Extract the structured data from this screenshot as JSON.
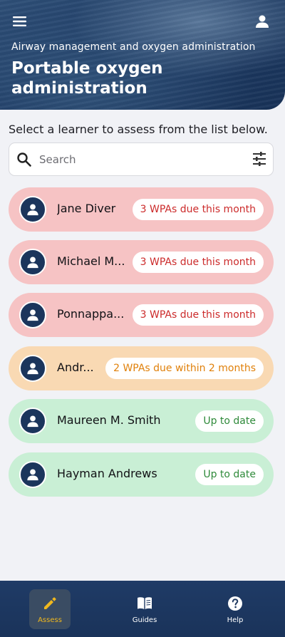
{
  "header": {
    "subtitle": "Airway management and oxygen administration",
    "title": "Portable oxygen administration",
    "menu_icon": "menu-icon",
    "user_icon": "account-icon"
  },
  "instruction": "Select a learner to assess from the list below.",
  "search": {
    "placeholder": "Search",
    "value": ""
  },
  "learners": [
    {
      "name": "Jane Diver",
      "status": "3 WPAs due this month",
      "level": "red"
    },
    {
      "name": "Michael M...",
      "status": "3 WPAs due this month",
      "level": "red"
    },
    {
      "name": "Ponnappa...",
      "status": "3 WPAs due this month",
      "level": "red"
    },
    {
      "name": "Andr...",
      "status": "2 WPAs due within 2 months",
      "level": "orange"
    },
    {
      "name": "Maureen M. Smith",
      "status": "Up to date",
      "level": "green"
    },
    {
      "name": "Hayman Andrews",
      "status": "Up to date",
      "level": "green"
    }
  ],
  "colors": {
    "red_card": "#f6c3c4",
    "orange_card": "#f9d9b3",
    "green_card": "#c9efd5",
    "navy": "#1b355c",
    "accent": "#f0b81e"
  },
  "nav": [
    {
      "label": "Assess",
      "icon": "pencil-icon",
      "active": true
    },
    {
      "label": "Guides",
      "icon": "book-icon",
      "active": false
    },
    {
      "label": "Help",
      "icon": "help-circle-icon",
      "active": false
    }
  ]
}
